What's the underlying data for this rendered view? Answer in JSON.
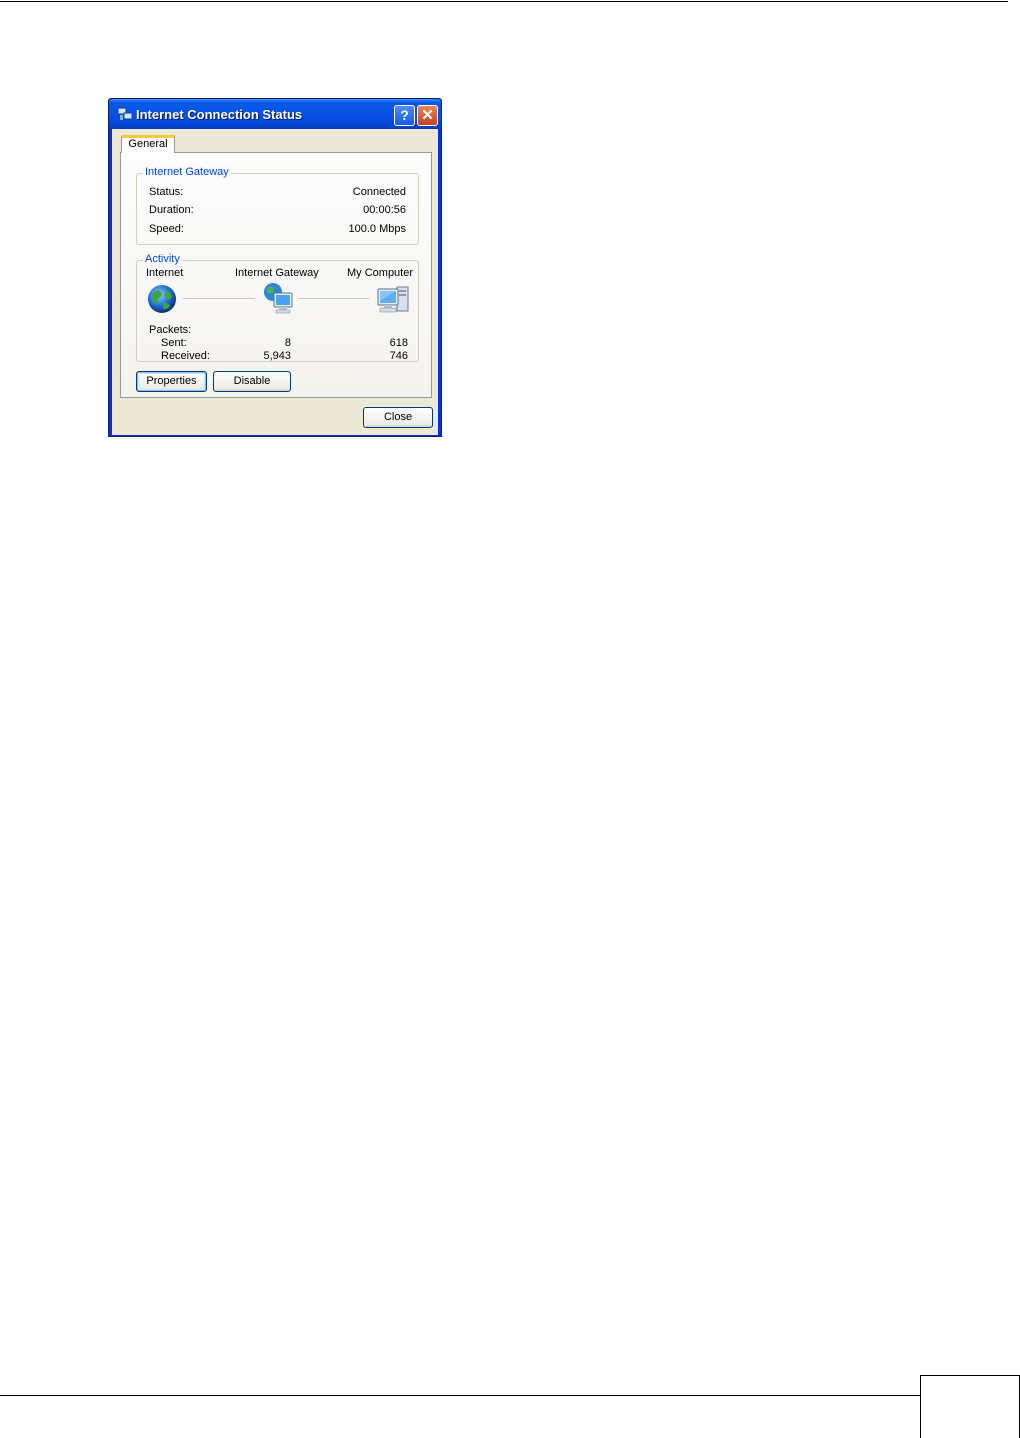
{
  "dialog": {
    "title": "Internet Connection Status",
    "help_glyph": "?",
    "close_glyph": "✕",
    "tab_general": "General",
    "gateway_group": {
      "title": "Internet Gateway",
      "rows": [
        {
          "label": "Status:",
          "value": "Connected"
        },
        {
          "label": "Duration:",
          "value": "00:00:56"
        },
        {
          "label": "Speed:",
          "value": "100.0 Mbps"
        }
      ]
    },
    "activity_group": {
      "title": "Activity",
      "nodes": [
        "Internet",
        "Internet Gateway",
        "My Computer"
      ],
      "packets_label": "Packets:",
      "sent_label": "Sent:",
      "received_label": "Received:",
      "sent_gateway": "8",
      "sent_computer": "618",
      "received_gateway": "5,943",
      "received_computer": "746"
    },
    "properties_label": "Properties",
    "disable_label": "Disable",
    "close_label": "Close"
  },
  "colors": {
    "titlebar": "#0752e4",
    "group_title": "#0046d5",
    "client_bg": "#ece9d8"
  },
  "icons": [
    "network-connection-icon",
    "globe-icon",
    "gateway-computer-icon",
    "my-computer-icon"
  ]
}
